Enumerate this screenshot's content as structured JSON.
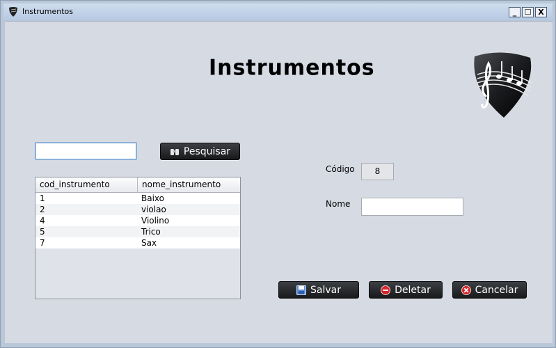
{
  "window": {
    "title": "Instrumentos",
    "controls": {
      "minimize": "_",
      "maximize": "☐",
      "close": "X"
    }
  },
  "header": {
    "title": "Instrumentos",
    "logo_icon": "guitar-pick-music-icon"
  },
  "search": {
    "value": "",
    "button_label": "Pesquisar",
    "button_icon": "binoculars-icon"
  },
  "table": {
    "columns": [
      "cod_instrumento",
      "nome_instrumento"
    ],
    "rows": [
      {
        "cod": "1",
        "nome": "Baixo"
      },
      {
        "cod": "2",
        "nome": "violao"
      },
      {
        "cod": "4",
        "nome": "Violino"
      },
      {
        "cod": "5",
        "nome": "Trico"
      },
      {
        "cod": "7",
        "nome": "Sax"
      }
    ]
  },
  "form": {
    "codigo_label": "Código",
    "codigo_value": "8",
    "nome_label": "Nome",
    "nome_value": ""
  },
  "actions": {
    "salvar": "Salvar",
    "deletar": "Deletar",
    "cancelar": "Cancelar"
  },
  "colors": {
    "background": "#d6dae3",
    "button_dark": "#1f2023",
    "close_red": "#d8262b",
    "save_blue": "#3a6fc4"
  }
}
